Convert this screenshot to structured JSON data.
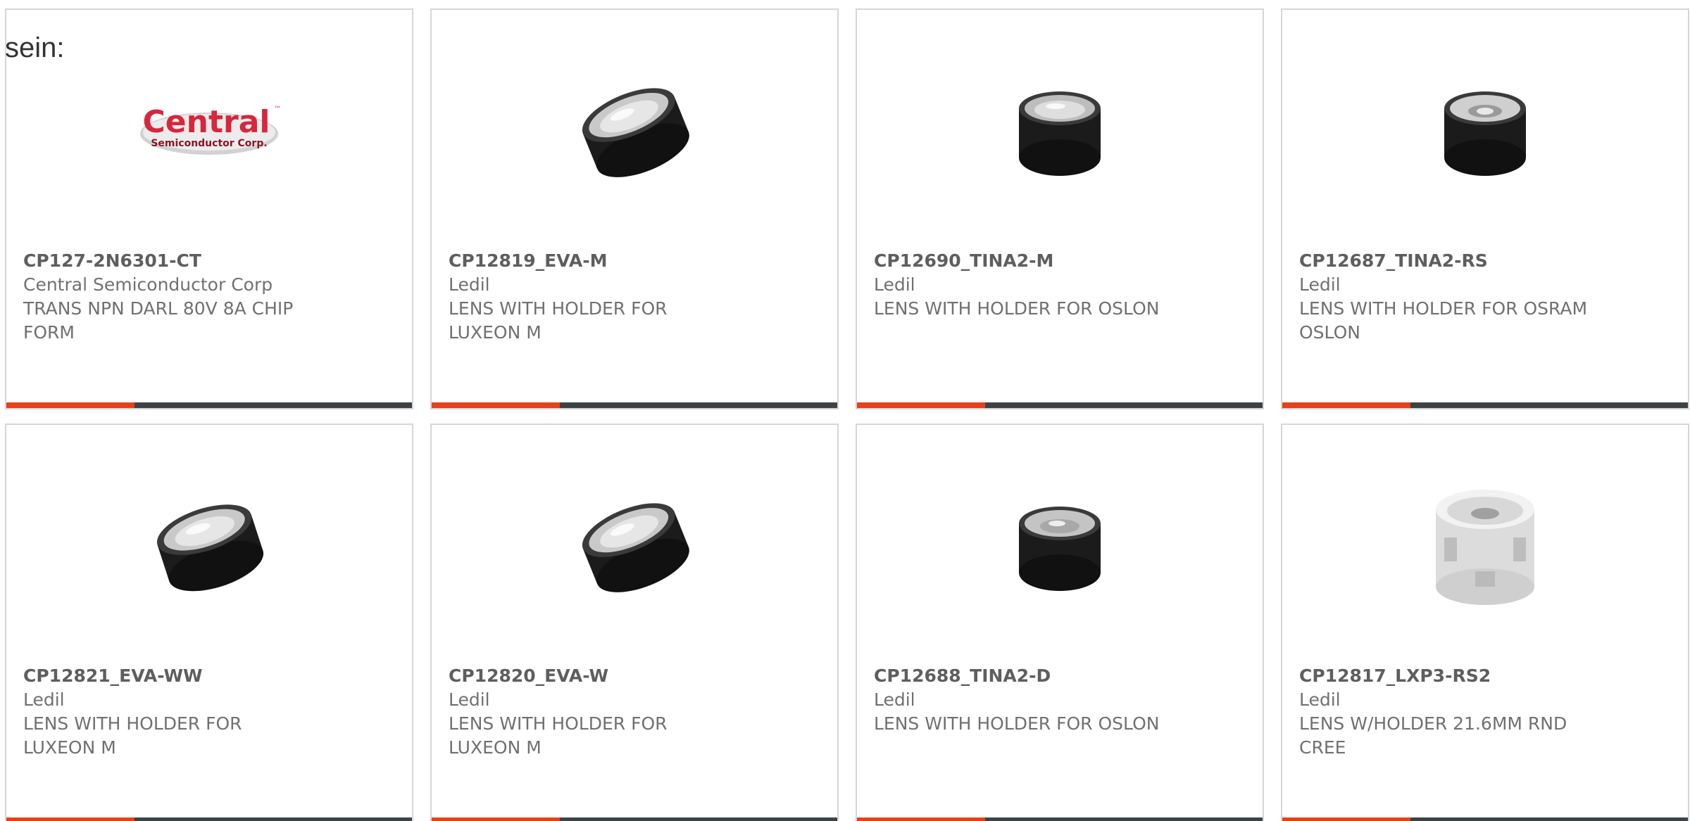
{
  "heading_fragment": "sein:",
  "colors": {
    "accent": "#e5421a",
    "bar_dark": "#3d4245",
    "card_border": "#d6d6d6",
    "text_gray": "#707070",
    "part_number": "#5e5e5e"
  },
  "products": [
    {
      "part_number": "CP127-2N6301-CT",
      "manufacturer": "Central Semiconductor Corp",
      "description": "TRANS NPN DARL 80V 8A CHIP FORM",
      "image": "central-semiconductor-logo",
      "logo": {
        "main": "Central",
        "tm": "™",
        "sub": "Semiconductor Corp."
      }
    },
    {
      "part_number": "CP12819_EVA-M",
      "manufacturer": "Ledil",
      "description": "LENS WITH HOLDER FOR LUXEON M",
      "image": "black-lens-holder-tilted"
    },
    {
      "part_number": "CP12690_TINA2-M",
      "manufacturer": "Ledil",
      "description": "LENS WITH HOLDER FOR OSLON",
      "image": "black-lens-holder-small"
    },
    {
      "part_number": "CP12687_TINA2-RS",
      "manufacturer": "Ledil",
      "description": "LENS WITH HOLDER FOR OSRAM OSLON",
      "image": "black-lens-holder-small"
    },
    {
      "part_number": "CP12821_EVA-WW",
      "manufacturer": "Ledil",
      "description": "LENS WITH HOLDER FOR LUXEON M",
      "image": "black-lens-holder-tilted"
    },
    {
      "part_number": "CP12820_EVA-W",
      "manufacturer": "Ledil",
      "description": "LENS WITH HOLDER FOR LUXEON M",
      "image": "black-lens-holder-tilted"
    },
    {
      "part_number": "CP12688_TINA2-D",
      "manufacturer": "Ledil",
      "description": "LENS WITH HOLDER FOR OSLON",
      "image": "black-lens-holder-small"
    },
    {
      "part_number": "CP12817_LXP3-RS2",
      "manufacturer": "Ledil",
      "description": "LENS W/HOLDER 21.6MM RND CREE",
      "image": "white-lens-holder"
    }
  ]
}
